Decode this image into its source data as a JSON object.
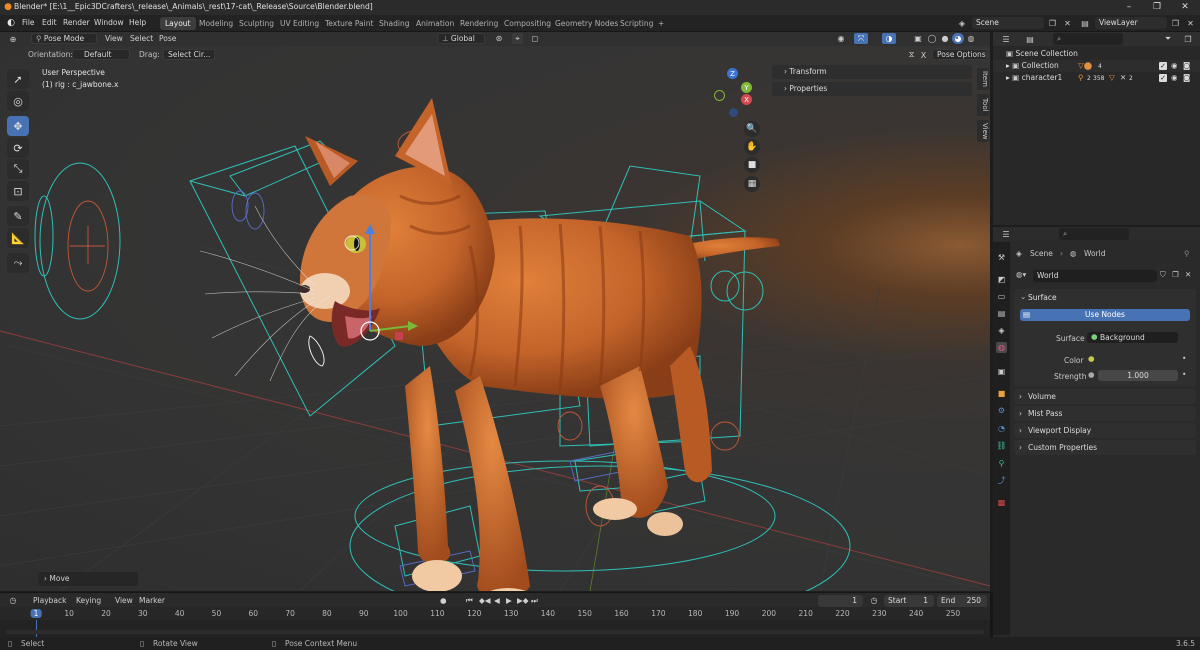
{
  "titlebar": {
    "title": "Blender* [E:\\1__Epic3DCrafters\\_release\\_Animals\\_rest\\17-cat\\_Release\\Source\\Blender.blend]"
  },
  "menus": [
    "File",
    "Edit",
    "Render",
    "Window",
    "Help"
  ],
  "workspaces": [
    "Layout",
    "Modeling",
    "Sculpting",
    "UV Editing",
    "Texture Paint",
    "Shading",
    "Animation",
    "Rendering",
    "Compositing",
    "Geometry Nodes",
    "Scripting",
    "+"
  ],
  "scene": "Scene",
  "view_layer": "ViewLayer",
  "viewport_header": {
    "mode": "Pose Mode",
    "menus": [
      "View",
      "Select",
      "Pose"
    ],
    "transform_orientation": "Global",
    "orientation_label": "Orientation:",
    "orientation_value": "Default",
    "drag_label": "Drag:",
    "drag_value": "Select Cir...",
    "pose_options": "Pose Options"
  },
  "viewport": {
    "perspective": "User Perspective",
    "active": "(1) rig : c_jawbone.x",
    "last_op": "Move",
    "sidebar_sections": [
      "Transform",
      "Properties"
    ],
    "sidebar_tabs": [
      "Item",
      "Tool",
      "View"
    ],
    "gizmo_axes": [
      "Z",
      "X",
      "Y"
    ]
  },
  "outliner": {
    "root": "Scene Collection",
    "items": [
      {
        "label": "Collection",
        "count": "4"
      },
      {
        "label": "character1",
        "count": "2",
        "count2": "358",
        "count3": "2"
      }
    ]
  },
  "properties": {
    "breadcrumb": [
      "Scene",
      "World"
    ],
    "world_name": "World",
    "surface_panel": "Surface",
    "use_nodes": "Use Nodes",
    "surface_label": "Surface",
    "surface_value": "Background",
    "color_label": "Color",
    "strength_label": "Strength",
    "strength_value": "1.000",
    "collapsed_panels": [
      "Volume",
      "Mist Pass",
      "Viewport Display",
      "Custom Properties"
    ]
  },
  "timeline": {
    "menus": [
      "Playback",
      "Keying",
      "View",
      "Marker"
    ],
    "current_frame": "1",
    "start_label": "Start",
    "start": "1",
    "end_label": "End",
    "end": "250",
    "ticks": [
      "1",
      "10",
      "20",
      "30",
      "40",
      "50",
      "60",
      "70",
      "80",
      "90",
      "100",
      "110",
      "120",
      "130",
      "140",
      "150",
      "160",
      "170",
      "180",
      "190",
      "200",
      "210",
      "220",
      "230",
      "240",
      "250"
    ]
  },
  "statusbar": {
    "items": [
      "Select",
      "Rotate View",
      "Pose Context Menu"
    ],
    "version": "3.6.5"
  },
  "colors": {
    "accent": "#4772b3",
    "rig": "#2fbfb6",
    "fur": "#c4642a"
  }
}
